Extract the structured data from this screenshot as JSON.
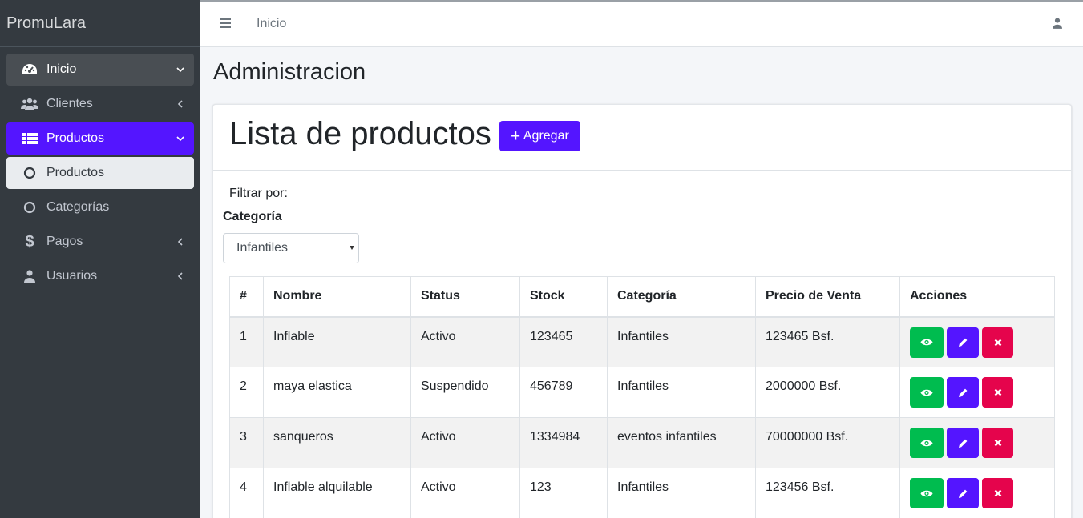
{
  "brand": "PromuLara",
  "sidebar": {
    "items": [
      {
        "label": "Inicio",
        "icon": "tachometer-icon"
      },
      {
        "label": "Clientes",
        "icon": "users-icon"
      },
      {
        "label": "Productos",
        "icon": "list-icon"
      },
      {
        "label": "Productos",
        "icon": "circle-icon"
      },
      {
        "label": "Categorías",
        "icon": "circle-icon"
      },
      {
        "label": "Pagos",
        "icon": "dollar-icon"
      },
      {
        "label": "Usuarios",
        "icon": "user-icon"
      }
    ]
  },
  "topbar": {
    "breadcrumb": "Inicio"
  },
  "page_title": "Administracion",
  "card": {
    "title": "Lista de productos",
    "add_button": "Agregar",
    "filter_label": "Filtrar por:",
    "category_label": "Categoría",
    "category_selected": "Infantiles"
  },
  "table": {
    "headers": [
      "#",
      "Nombre",
      "Status",
      "Stock",
      "Categoría",
      "Precio de Venta",
      "Acciones"
    ],
    "rows": [
      [
        "1",
        "Inflable",
        "Activo",
        "123465",
        "Infantiles",
        "123465 Bsf."
      ],
      [
        "2",
        "maya elastica",
        "Suspendido",
        "456789",
        "Infantiles",
        "2000000 Bsf."
      ],
      [
        "3",
        "sanqueros",
        "Activo",
        "1334984",
        "eventos infantiles",
        "70000000 Bsf."
      ],
      [
        "4",
        "Inflable alquilable",
        "Activo",
        "123",
        "Infantiles",
        "123456 Bsf."
      ]
    ]
  },
  "colors": {
    "sidebar_bg": "#343a40",
    "primary": "#5415ff",
    "success": "#00bc4f",
    "danger": "#e5044c"
  }
}
